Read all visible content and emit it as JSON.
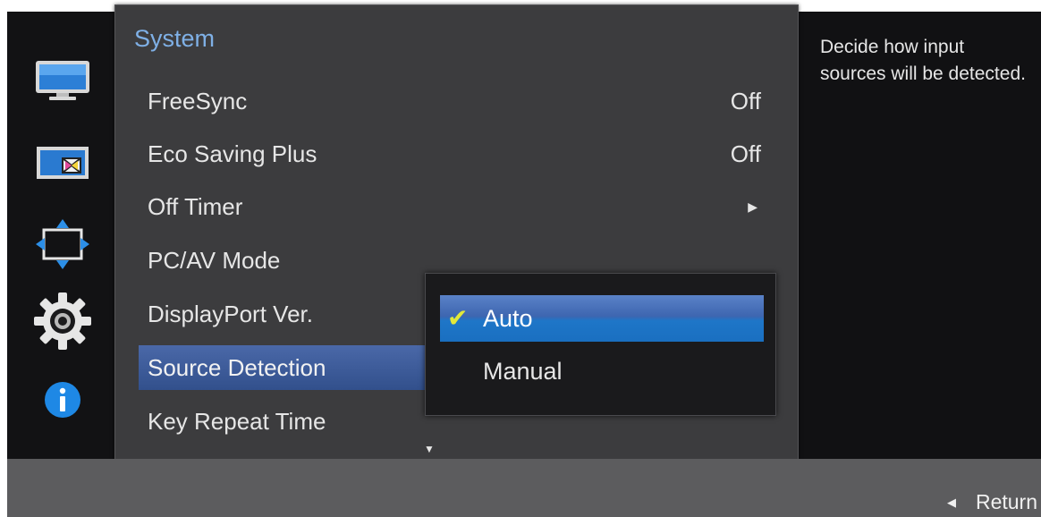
{
  "panel": {
    "title": "System"
  },
  "menu": {
    "items": [
      {
        "label": "FreeSync",
        "value": "Off"
      },
      {
        "label": "Eco Saving Plus",
        "value": "Off"
      },
      {
        "label": "Off Timer",
        "value": ""
      },
      {
        "label": "PC/AV Mode",
        "value": ""
      },
      {
        "label": "DisplayPort Ver.",
        "value": ""
      },
      {
        "label": "Source Detection",
        "value": ""
      },
      {
        "label": "Key Repeat Time",
        "value": ""
      }
    ],
    "selected_index": 5
  },
  "dropdown": {
    "options": [
      "Auto",
      "Manual"
    ],
    "selected": "Auto"
  },
  "help": {
    "text": "Decide how input sources will be detected."
  },
  "footer": {
    "return_label": "Return"
  },
  "icons": {
    "sidebar": [
      "monitor-icon",
      "picture-size-icon",
      "position-arrows-icon",
      "gear-icon",
      "info-icon"
    ],
    "submenu_arrow": "right-triangle-icon",
    "scroll_more": "down-triangle-icon",
    "check": "check-icon",
    "return": "left-triangle-icon"
  },
  "colors": {
    "title": "#7fb0e6",
    "selection_blue": "#3e66b0",
    "check_yellow": "#e2e83a",
    "info_blue": "#1e88e5"
  }
}
